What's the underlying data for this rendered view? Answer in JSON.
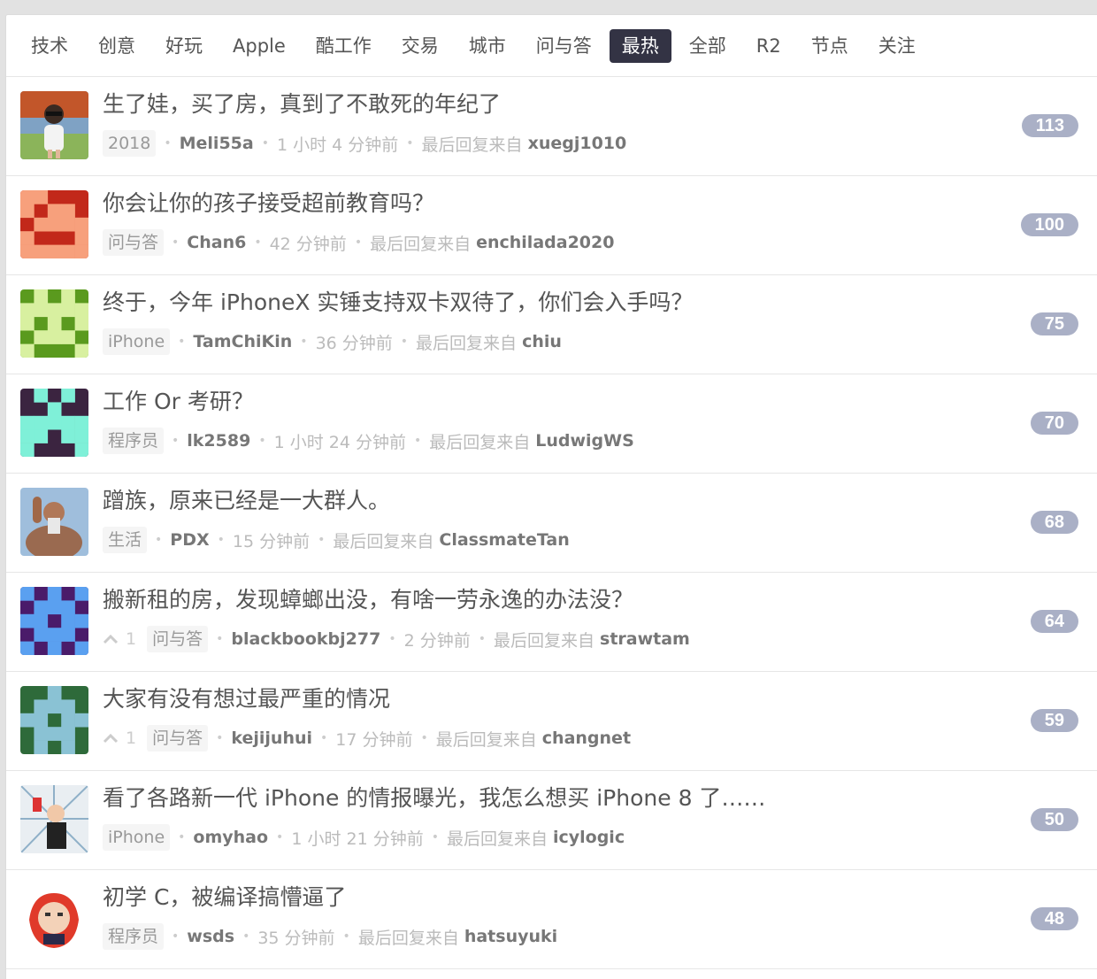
{
  "tabs": [
    {
      "label": "技术",
      "active": false
    },
    {
      "label": "创意",
      "active": false
    },
    {
      "label": "好玩",
      "active": false
    },
    {
      "label": "Apple",
      "active": false
    },
    {
      "label": "酷工作",
      "active": false
    },
    {
      "label": "交易",
      "active": false
    },
    {
      "label": "城市",
      "active": false
    },
    {
      "label": "问与答",
      "active": false
    },
    {
      "label": "最热",
      "active": true
    },
    {
      "label": "全部",
      "active": false
    },
    {
      "label": "R2",
      "active": false
    },
    {
      "label": "节点",
      "active": false
    },
    {
      "label": "关注",
      "active": false
    }
  ],
  "last_reply_label": "最后回复来自",
  "topics": [
    {
      "title": "生了娃，买了房，真到了不敢死的年纪了",
      "node": "2018",
      "votes": "",
      "author": "Meli55a",
      "time": "1 小时 4 分钟前",
      "last_reply_by": "xuegj1010",
      "replies": "113",
      "avatar": "photo-child"
    },
    {
      "title": "你会让你的孩子接受超前教育吗？",
      "node": "问与答",
      "votes": "",
      "author": "Chan6",
      "time": "42 分钟前",
      "last_reply_by": "enchilada2020",
      "replies": "100",
      "avatar": "pixel-red"
    },
    {
      "title": "终于，今年 iPhoneX 实锤支持双卡双待了，你们会入手吗？",
      "node": "iPhone",
      "votes": "",
      "author": "TamChiKin",
      "time": "36 分钟前",
      "last_reply_by": "chiu",
      "replies": "75",
      "avatar": "pixel-green"
    },
    {
      "title": "工作 Or 考研？",
      "node": "程序员",
      "votes": "",
      "author": "lk2589",
      "time": "1 小时 24 分钟前",
      "last_reply_by": "LudwigWS",
      "replies": "70",
      "avatar": "pixel-teal"
    },
    {
      "title": "蹭族，原来已经是一大群人。",
      "node": "生活",
      "votes": "",
      "author": "PDX",
      "time": "15 分钟前",
      "last_reply_by": "ClassmateTan",
      "replies": "68",
      "avatar": "photo-muscle"
    },
    {
      "title": "搬新租的房，发现蟑螂出没，有啥一劳永逸的办法没？",
      "node": "问与答",
      "votes": "1",
      "author": "blackbookbj277",
      "time": "2 分钟前",
      "last_reply_by": "strawtam",
      "replies": "64",
      "avatar": "pixel-purple"
    },
    {
      "title": "大家有没有想过最严重的情况",
      "node": "问与答",
      "votes": "1",
      "author": "kejijuhui",
      "time": "17 分钟前",
      "last_reply_by": "changnet",
      "replies": "59",
      "avatar": "pixel-darkgreen"
    },
    {
      "title": "看了各路新一代 iPhone 的情报曝光，我怎么想买 iPhone 8 了……",
      "node": "iPhone",
      "votes": "",
      "author": "omyhao",
      "time": "1 小时 21 分钟前",
      "last_reply_by": "icylogic",
      "replies": "50",
      "avatar": "illustration-man"
    },
    {
      "title": "初学 C，被编译搞懵逼了",
      "node": "程序员",
      "votes": "",
      "author": "wsds",
      "time": "35 分钟前",
      "last_reply_by": "hatsuyuki",
      "replies": "48",
      "avatar": "mascot-jenkins"
    }
  ]
}
